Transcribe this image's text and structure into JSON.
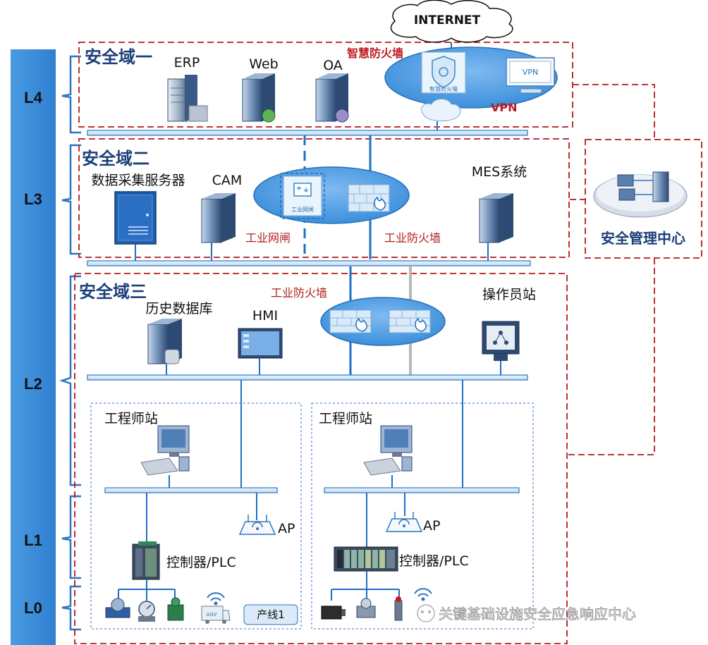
{
  "internet": "INTERNET",
  "levels": [
    "L4",
    "L3",
    "L2",
    "L1",
    "L0"
  ],
  "zones": {
    "zone1": "安全域一",
    "zone2": "安全域二",
    "zone3": "安全域三"
  },
  "l4_servers": [
    "ERP",
    "Web",
    "OA"
  ],
  "smart_firewall": "智慧防火墙",
  "smart_firewall_icon_text": "智慧防火墙",
  "vpn": "VPN",
  "vpn_device_text": "VPN",
  "l3": {
    "collector": "数据采集服务器",
    "cam": "CAM",
    "mes": "MES系统",
    "gatekeeper": "工业网闸",
    "gatekeeper_icon_text": "工业网闸",
    "firewall": "工业防火墙"
  },
  "l2": {
    "firewall": "工业防火墙",
    "historian": "历史数据库",
    "hmi": "HMI",
    "operator": "操作员站"
  },
  "lines": {
    "engineer_left": "工程师站",
    "engineer_right": "工程师站",
    "ap_left": "AP",
    "ap_right": "AP",
    "plc_left": "控制器/PLC",
    "plc_right": "控制器/PLC",
    "line_tag": "产线1",
    "agv_text": "AGV"
  },
  "security_center": "安全管理中心",
  "watermark": "关键基础设施安全应急响应中心",
  "colors": {
    "level_bar": "#3c8fdc",
    "bus": "#d9ebf8",
    "bus_stroke": "#2f74c0",
    "cloud_ellipse": "#5aa2e6",
    "zone_border": "#b21a1f",
    "link": "#1f6fc6"
  }
}
